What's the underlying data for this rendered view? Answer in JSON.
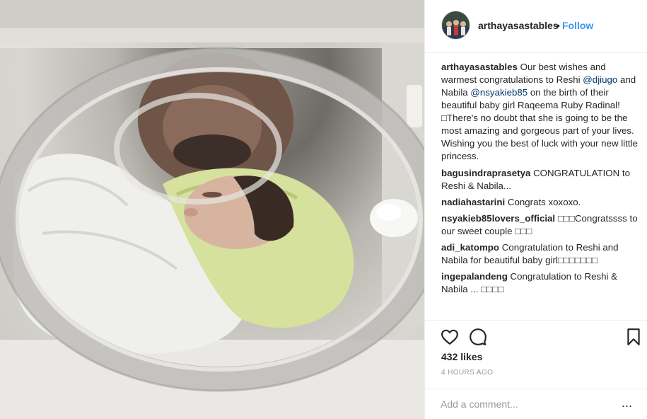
{
  "post": {
    "image_alt": "Newborn baby in incubator wrapped in towels"
  },
  "header": {
    "username": "arthayasastables",
    "separator": "•",
    "follow_label": "Follow"
  },
  "caption": {
    "username": "arthayasastables",
    "text_1": " Our best wishes and warmest congratulations to Reshi ",
    "mention_1": "@djiugo",
    "text_2": " and Nabila ",
    "mention_2": "@nsyakieb85",
    "text_3": " on the birth of their beautiful baby girl Raqeema Ruby Radinal! □There's no doubt that she is going to be the most amazing and gorgeous part of your lives. Wishing you the best of luck with your new little princess."
  },
  "comments": [
    {
      "username": "bagusindraprasetya",
      "text": " CONGRATULATION to Reshi & Nabila..."
    },
    {
      "username": "nadiahastarini",
      "text": " Congrats xoxoxo."
    },
    {
      "username": "nsyakieb85lovers_official",
      "text": " □□□Congratssss to our sweet couple □□□"
    },
    {
      "username": "adi_katompo",
      "text": " Congratulation to Reshi and Nabila for beautiful baby girl□□□□□□□"
    },
    {
      "username": "ingepalandeng",
      "text": " Congratulation to Reshi & Nabila ... □□□□"
    }
  ],
  "actions": {
    "like_icon": "heart-icon",
    "comment_icon": "comment-bubble-icon",
    "save_icon": "bookmark-icon",
    "likes": "432 likes",
    "timestamp": "4 HOURS AGO"
  },
  "add_comment": {
    "placeholder": "Add a comment...",
    "more": "..."
  },
  "colors": {
    "link": "#3897f0",
    "mention": "#003569",
    "muted": "#999999",
    "text": "#262626"
  }
}
